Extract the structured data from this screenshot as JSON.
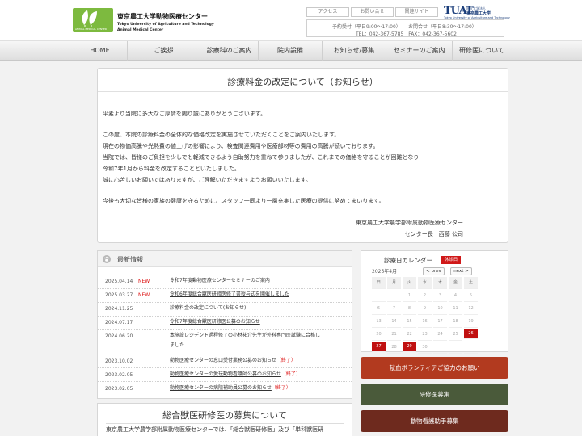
{
  "header": {
    "logo_sub": "ANIMAL MEDICAL CENTER",
    "title_ja": "東京農工大学動物医療センター",
    "title_en_1": "Tokyo University of Agriculture and Technology",
    "title_en_2": "Animal Medical Center",
    "top_links": [
      "アクセス",
      "お問い合せ",
      "関連サイト"
    ],
    "tuat": {
      "mark": "TUAT",
      "ja_small": "国立大学法人",
      "ja_name": "東京農工大学",
      "en_name": "Tokyo University of Agriculture and Technology"
    },
    "contact": {
      "reservation": "予約受付（平日9:00〜17:00）",
      "inquiry": "お問合せ（平日8:30〜17:00）",
      "phones": "TEL：042-367-5785　FAX：042-367-5602"
    }
  },
  "nav": {
    "items": [
      "HOME",
      "ご挨拶",
      "診療科のご案内",
      "院内設備",
      "お知らせ/募集",
      "セミナーのご案内",
      "研修医について"
    ]
  },
  "notice": {
    "title": "診療料金の改定について（お知らせ）",
    "paragraphs": [
      "平素より当院に多大なご厚情を賜り誠にありがとうございます。",
      "この度、本院の診療料金の全体的な価格改定を実施させていただくことをご案内いたします。",
      "現在の物価高騰や光熱費の値上げの影響により、検査関連費用や医療部材等の費用の高騰が続いております。",
      "当院では、皆様のご負担を少しでも軽減できるよう自助努力を重ねて参りましたが、これまでの価格を守ることが困難となり",
      "令和7年1月から料金を改定することといたしました。",
      "誠に心苦しいお願いではありますが、ご理解いただきますようお願いいたします。",
      "今後も大切な皆様の家族の健康を守るために、スタッフ一同より一層充実した医療の提供に努めてまいります。"
    ],
    "signature_org": "東京農工大学農学部附属動物医療センター",
    "signature_name": "センター長　西藤 公司"
  },
  "news": {
    "title": "最新情報",
    "items": [
      {
        "date": "2025.04.14",
        "badge": "NEW",
        "text": "令和7年度動物医療センターセミナーのご案内",
        "end": ""
      },
      {
        "date": "2025.03.27",
        "badge": "NEW",
        "text": "令和6年度総合獣医研修医修了書授与式を開催しました",
        "end": ""
      },
      {
        "date": "2024.11.25",
        "badge": "",
        "text": "診療料金の改定について(お知らせ)",
        "end": ""
      },
      {
        "date": "2024.07.17",
        "badge": "",
        "text": "令和7年度総合獣医研修医公募のお知らせ",
        "end": ""
      },
      {
        "date": "2024.06.20",
        "badge": "",
        "text": "本施設レジデント過程修了の小材祐介先生が外科専門医試験に合格し",
        "text2": "ました",
        "end": ""
      },
      {
        "date": "2023.10.02",
        "badge": "",
        "text": "動物医療センターの窓口受付業務公募のお知らせ",
        "end": "（終了）"
      },
      {
        "date": "2023.02.05",
        "badge": "",
        "text": "動物医療センターの愛玩動物看護師公募のお知らせ",
        "end": "（終了）"
      },
      {
        "date": "2023.02.05",
        "badge": "",
        "text": "動物医療センターの病院補助員公募のお知らせ",
        "end": "（終了）"
      }
    ]
  },
  "recruit": {
    "title": "総合獣医研修医の募集について",
    "text": "東京農工大学農学部附属動物医療センターでは、「総合獣医研修医」及び「単科獣医研"
  },
  "calendar": {
    "title": "診療日カレンダー",
    "holiday_label": "休診日",
    "month": "2025年4月",
    "prev": "< prev",
    "next": "next >",
    "weekdays": [
      "日",
      "月",
      "火",
      "水",
      "木",
      "金",
      "土"
    ],
    "weeks": [
      [
        "",
        "",
        "1",
        "2",
        "3",
        "4",
        "5"
      ],
      [
        "6",
        "7",
        "8",
        "9",
        "10",
        "11",
        "12"
      ],
      [
        "13",
        "14",
        "15",
        "16",
        "17",
        "18",
        "19"
      ],
      [
        "20",
        "21",
        "22",
        "23",
        "24",
        "25",
        "26"
      ],
      [
        "27",
        "28",
        "29",
        "30",
        "",
        "",
        ""
      ]
    ],
    "holidays": [
      "26",
      "27",
      "29"
    ],
    "holiday_color": "#c01010"
  },
  "side_buttons": [
    {
      "label": "献血ボランティアご協力のお願い",
      "color": "#b23a1f"
    },
    {
      "label": "研修医募集",
      "color": "#4a5a3a"
    },
    {
      "label": "動物看護助手募集",
      "color": "#6e2a1e"
    }
  ]
}
